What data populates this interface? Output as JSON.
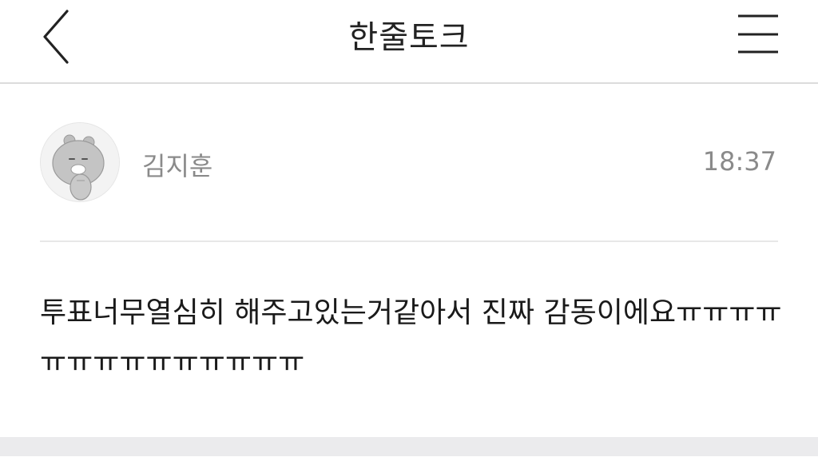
{
  "header": {
    "title": "한줄토크",
    "back_icon": "chevron-left-icon",
    "menu_icon": "hamburger-menu-icon"
  },
  "post": {
    "author": "김지훈",
    "time": "18:37",
    "avatar_icon": "bear-character-avatar",
    "message": "투표너무열심히 해주고있는거같아서 진짜 감동이에요ㅠㅠㅠㅠㅠㅠㅠㅠㅠㅠㅠㅠㅠㅠ"
  },
  "colors": {
    "title_text": "#222222",
    "meta_text": "#8a8a8a",
    "message_text": "#1a1a1a",
    "divider": "#dcdcdc",
    "footer_band": "#ebebed"
  }
}
